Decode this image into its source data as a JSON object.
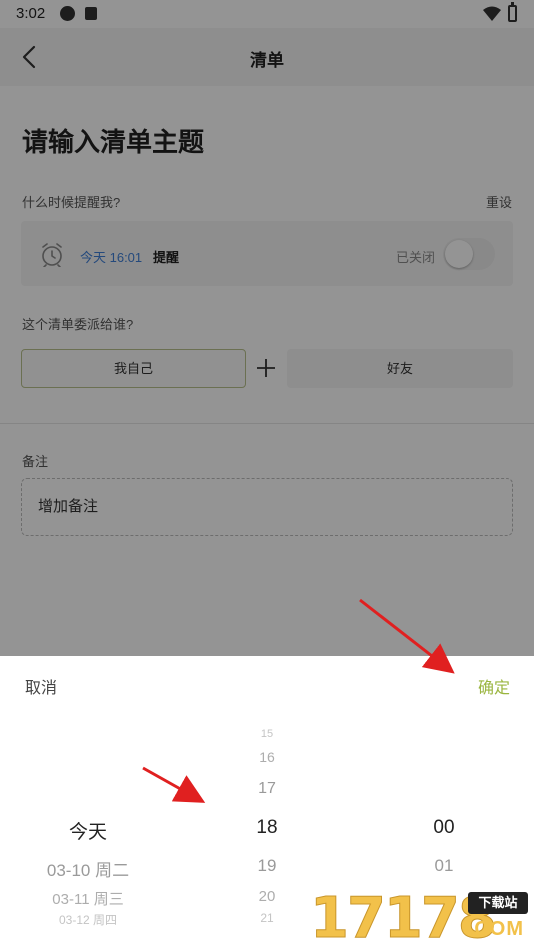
{
  "status_bar": {
    "time": "3:02"
  },
  "top_bar": {
    "title": "清单"
  },
  "form": {
    "title": "请输入清单主题",
    "remind_label": "什么时候提醒我?",
    "reset_label": "重设",
    "remind": {
      "time": "今天 16:01",
      "label": "提醒",
      "toggle_state": "已关闭",
      "toggle_on": false
    },
    "assign_label": "这个清单委派给谁?",
    "assign_self": "我自己",
    "assign_friend": "好友",
    "note_label": "备注",
    "note_placeholder": "增加备注"
  },
  "picker": {
    "cancel_label": "取消",
    "confirm_label": "确定",
    "accent_color": "#9ab53f",
    "day_selected": "今天",
    "day_below": [
      "03-10 周二",
      "03-11 周三",
      "03-12 周四"
    ],
    "hour_above": [
      "15",
      "16",
      "17"
    ],
    "hour_selected": "18",
    "hour_below": [
      "19",
      "20",
      "21"
    ],
    "minute_selected": "00",
    "minute_below": [
      "01"
    ]
  },
  "watermark": {
    "digits": "17178",
    "badge": "下载站",
    "domain": ".COM"
  }
}
